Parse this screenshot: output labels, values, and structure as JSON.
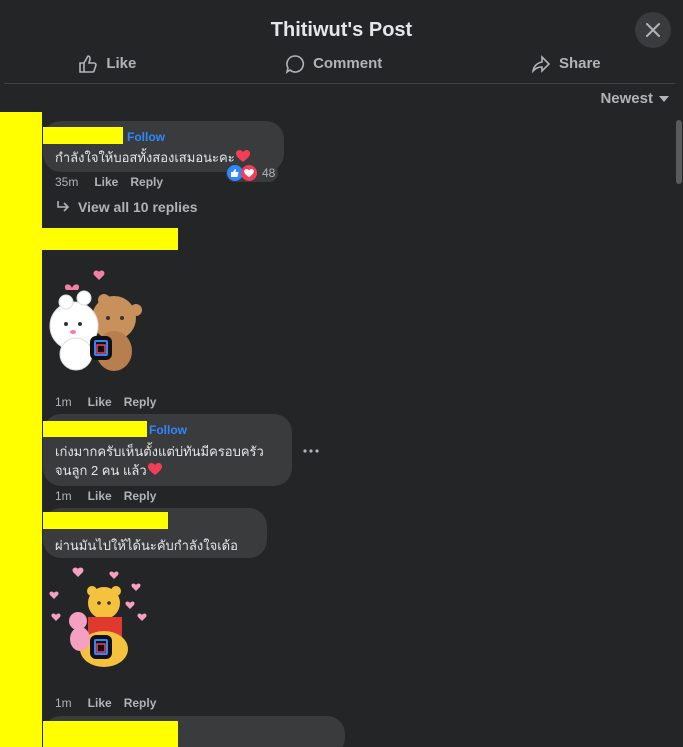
{
  "header": {
    "title": "Thitiwut's Post"
  },
  "actions": {
    "like": "Like",
    "comment": "Comment",
    "share": "Share"
  },
  "sort": {
    "label": "Newest"
  },
  "comments": [
    {
      "follow": "Follow",
      "text": "กำลังใจให้บอสทั้งสองเสมอนะคะ",
      "time": "35m",
      "like": "Like",
      "reply": "Reply",
      "reaction_count": "48",
      "view_replies": "View all 10 replies"
    },
    {
      "time": "1m",
      "like": "Like",
      "reply": "Reply"
    },
    {
      "follow": "Follow",
      "line1": "เก่งมากครับเห็นตั้งแต่บ่ทันมีครอบครัว",
      "line2": "จนลูก 2 คน แล้ว",
      "time": "1m",
      "like": "Like",
      "reply": "Reply"
    },
    {
      "text": "ผ่านมันไปให้ได้นะคับกำลังใจเด้อ"
    },
    {
      "time": "1m",
      "like": "Like",
      "reply": "Reply"
    }
  ],
  "colors": {
    "background": "#242526",
    "bubble": "#3a3b3c",
    "link": "#2d88ff",
    "redaction": "#ffff00",
    "heart": "#f33e58"
  }
}
